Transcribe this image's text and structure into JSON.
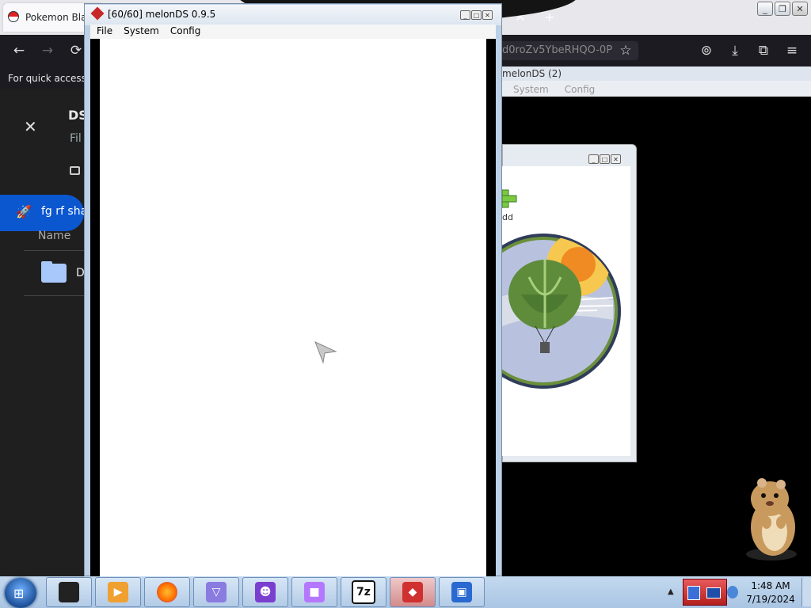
{
  "browser": {
    "tab_title": "Pokemon Black",
    "url_partial": "d0roZv5YbeRHQO-0P",
    "bookmarks_hint": "For quick access, p",
    "nav": {
      "back": "←",
      "forward": "→",
      "reload": "⟳",
      "star": "☆",
      "pocket": "⊚",
      "download": "⤓",
      "extensions": "⧉",
      "menu": "≡"
    },
    "tab_close": "✕",
    "new_tab": "+"
  },
  "drive_page": {
    "close": "✕",
    "title": "DS",
    "subtitle": "Fil",
    "shared_label": "fg rf sha",
    "column_name": "Name",
    "folder_name": "D"
  },
  "back_window": {
    "title": "melonDS (2)",
    "menu": [
      "System",
      "Config"
    ]
  },
  "dialog": {
    "add_label": "dd",
    "controls": [
      "_",
      "□",
      "✕"
    ]
  },
  "front_window": {
    "title": "[60/60] melonDS 0.9.5",
    "menu": [
      "File",
      "System",
      "Config"
    ],
    "controls": [
      "_",
      "□",
      "✕"
    ]
  },
  "desktop_window_controls": [
    "_",
    "❐",
    "✕"
  ],
  "taskbar": {
    "apps": [
      {
        "name": "terminal-app",
        "label": "",
        "color": "#222222"
      },
      {
        "name": "media-player-app",
        "label": "▶",
        "color": "#f0a030"
      },
      {
        "name": "firefox-app",
        "label": "",
        "color": "#ff6a00"
      },
      {
        "name": "app-triangles",
        "label": "▽",
        "color": "#8a7be0"
      },
      {
        "name": "app-spiky",
        "label": "☻",
        "color": "#7b3fd0"
      },
      {
        "name": "app-cube",
        "label": "■",
        "color": "#b478ff"
      },
      {
        "name": "7zip-app",
        "label": "7z",
        "color": "#111111"
      },
      {
        "name": "melonds-app",
        "label": "◆",
        "color": "#d03030"
      },
      {
        "name": "virtualbox-app",
        "label": "▣",
        "color": "#2a6ad0"
      }
    ],
    "tray_up": "▲",
    "clock_time": "1:48 AM",
    "clock_date": "7/19/2024"
  }
}
